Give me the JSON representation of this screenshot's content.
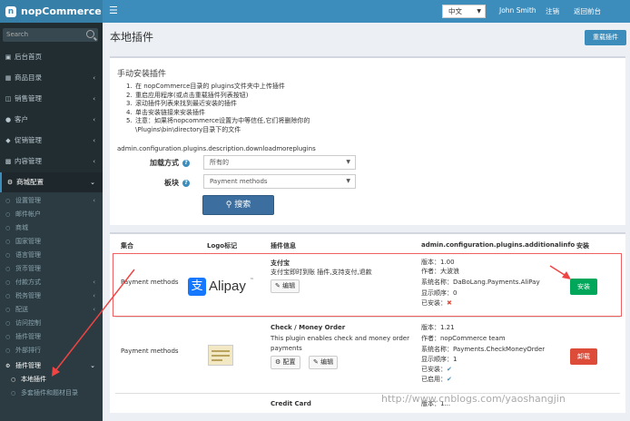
{
  "app": {
    "logo_text": "nopCommerce"
  },
  "header": {
    "language": "中文",
    "user": "John Smith",
    "logout": "注销",
    "back_to_store": "返回前台"
  },
  "sidebar": {
    "search_placeholder": "Search",
    "items": [
      {
        "label": "后台首页",
        "icon": "desktop-icon"
      },
      {
        "label": "商品目录",
        "icon": "book-icon"
      },
      {
        "label": "销售管理",
        "icon": "cart-icon"
      },
      {
        "label": "客户",
        "icon": "user-icon"
      },
      {
        "label": "促销管理",
        "icon": "tags-icon"
      },
      {
        "label": "内容管理",
        "icon": "cubes-icon"
      },
      {
        "label": "商城配置",
        "icon": "gears-icon"
      }
    ],
    "config_sub": [
      "设置管理",
      "邮件帐户",
      "商城",
      "国家管理",
      "语言管理",
      "货币管理",
      "付款方式",
      "税务管理",
      "配送",
      "访问控制",
      "插件管理",
      "外部排行"
    ],
    "plugin_group": "插件管理",
    "plugin_sub": [
      "本地插件",
      "多套插件和题材目录"
    ]
  },
  "page": {
    "title": "本地插件",
    "reload_button": "重载插件"
  },
  "manual_install": {
    "title": "手动安装插件",
    "steps": [
      {
        "num": "1.",
        "text": "在 nopCommerce目录的 plugins文件夹中上传插件"
      },
      {
        "num": "2.",
        "text": "重启应用程序(或点击重载插件列表按钮)"
      },
      {
        "num": "3.",
        "text": "滚动插件列表来找到最近安装的插件"
      },
      {
        "num": "4.",
        "text": "单击安装链接来安装插件"
      },
      {
        "num": "5.",
        "text": "注意：如果将nopcommerce设置为中等信任,它们将删除你的"
      },
      {
        "num": "",
        "text": "\\Plugins\\bin\\directory目录下的文件"
      }
    ],
    "config_key": "admin.configuration.plugins.description.downloadmoreplugins"
  },
  "filters": {
    "load_mode_label": "加载方式",
    "load_mode_value": "所有的",
    "group_label": "板块",
    "group_value": "Payment methods",
    "search_button": "搜索"
  },
  "table": {
    "headers": [
      "集合",
      "Logo标记",
      "插件信息",
      "admin.configuration.plugins.additionalinfo",
      "安装"
    ],
    "rows": [
      {
        "group": "Payment methods",
        "logo": "Alipay",
        "name": "支付宝",
        "description": "支付宝即时到账 插件,支持支付,退款",
        "edit": "编辑",
        "version": "版本：1.00",
        "author": "作者：大波浪",
        "system_name": "系统名称：DaBoLang.Payments.AliPay",
        "display_order": "显示顺序：0",
        "installed": "已安装：",
        "action": "安装"
      },
      {
        "group": "Payment methods",
        "name": "Check / Money Order",
        "description_1": "This plugin enables check and money order",
        "description_2": "payments",
        "configure": "配置",
        "edit": "编辑",
        "version": "版本：1.21",
        "author": "作者：nopCommerce team",
        "system_name": "系统名称：Payments.CheckMoneyOrder",
        "display_order": "显示顺序：1",
        "installed": "已安装：",
        "enabled": "已启用：",
        "action": "卸载"
      },
      {
        "name": "Credit Card",
        "version": "版本：1..."
      }
    ]
  },
  "watermark": "http://www.cnblogs.com/yaoshangjin",
  "colors": {
    "primary": "#3c8dbc",
    "sidebar": "#222d32",
    "install": "#00a65a",
    "uninstall": "#dd4b39",
    "highlight": "#ef6161"
  }
}
